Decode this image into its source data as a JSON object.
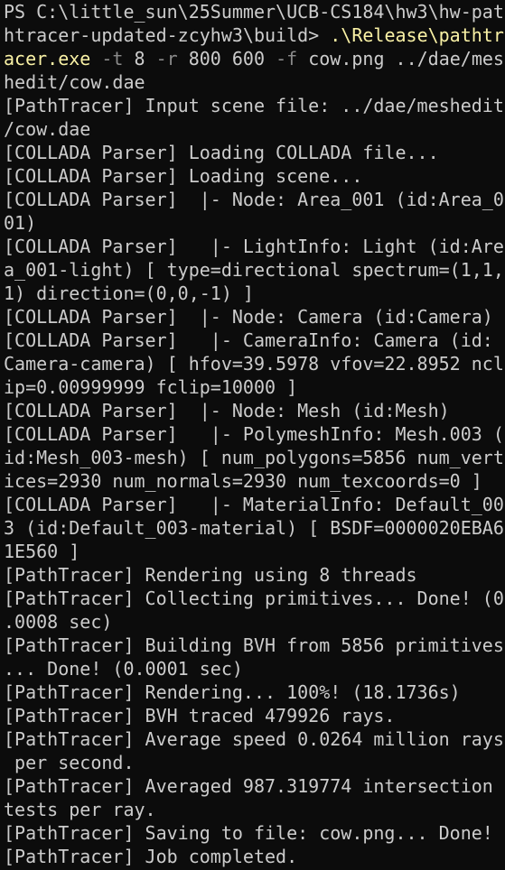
{
  "colors": {
    "background": "#0c0c0c",
    "text": "#cccccc",
    "command": "#f9f1a5",
    "flag": "#8a8a8a"
  },
  "prompt_lines": [
    [
      {
        "k": "prompt",
        "t": "PS C:\\little_sun\\25Summer\\UCB-CS184\\hw3\\hw-pat"
      }
    ],
    [
      {
        "k": "prompt",
        "t": "htracer-updated-zcyhw3\\build> "
      },
      {
        "k": "cmd",
        "t": ".\\Release\\pathtr"
      }
    ],
    [
      {
        "k": "cmd",
        "t": "acer.exe"
      },
      {
        "k": "arg",
        "t": " "
      },
      {
        "k": "flag",
        "t": "-t"
      },
      {
        "k": "arg",
        "t": " 8 "
      },
      {
        "k": "flag",
        "t": "-r"
      },
      {
        "k": "arg",
        "t": " 800 600 "
      },
      {
        "k": "flag",
        "t": "-f"
      },
      {
        "k": "arg",
        "t": " cow.png ../dae/mes"
      }
    ],
    [
      {
        "k": "arg",
        "t": "hedit/cow.dae"
      }
    ]
  ],
  "output_lines": [
    "[PathTracer] Input scene file: ../dae/meshedit",
    "/cow.dae",
    "[COLLADA Parser] Loading COLLADA file...",
    "[COLLADA Parser] Loading scene...",
    "[COLLADA Parser]  |- Node: Area_001 (id:Area_0",
    "01)",
    "[COLLADA Parser]   |- LightInfo: Light (id:Are",
    "a_001-light) [ type=directional spectrum=(1,1,",
    "1) direction=(0,0,-1) ]",
    "[COLLADA Parser]  |- Node: Camera (id:Camera)",
    "[COLLADA Parser]   |- CameraInfo: Camera (id:",
    "Camera-camera) [ hfov=39.5978 vfov=22.8952 ncl",
    "ip=0.00999999 fclip=10000 ]",
    "[COLLADA Parser]  |- Node: Mesh (id:Mesh)",
    "[COLLADA Parser]   |- PolymeshInfo: Mesh.003 (",
    "id:Mesh_003-mesh) [ num_polygons=5856 num_vert",
    "ices=2930 num_normals=2930 num_texcoords=0 ]",
    "[COLLADA Parser]   |- MaterialInfo: Default_00",
    "3 (id:Default_003-material) [ BSDF=0000020EBA6",
    "1E560 ]",
    "[PathTracer] Rendering using 8 threads",
    "[PathTracer] Collecting primitives... Done! (0",
    ".0008 sec)",
    "[PathTracer] Building BVH from 5856 primitives",
    "... Done! (0.0001 sec)",
    "[PathTracer] Rendering... 100%! (18.1736s)",
    "[PathTracer] BVH traced 479926 rays.",
    "[PathTracer] Average speed 0.0264 million rays",
    " per second.",
    "[PathTracer] Averaged 987.319774 intersection",
    "tests per ray.",
    "[PathTracer] Saving to file: cow.png... Done!",
    "[PathTracer] Job completed."
  ]
}
